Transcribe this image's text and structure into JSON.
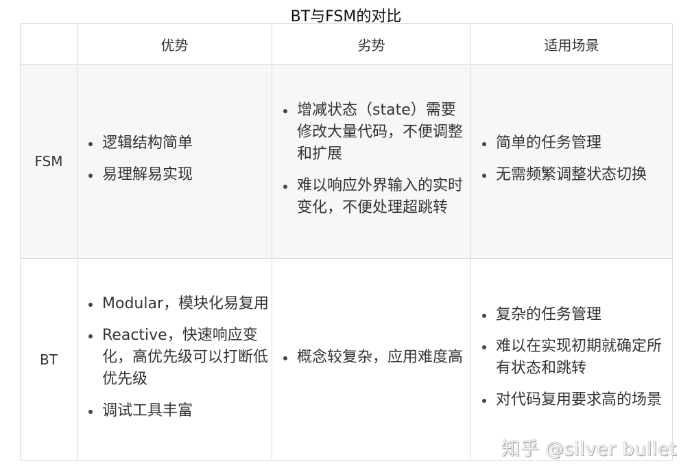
{
  "title": "BT与FSM的对比",
  "headers": [
    "",
    "优势",
    "劣势",
    "适用场景"
  ],
  "rows": [
    {
      "label": "FSM",
      "advantages": [
        "逻辑结构简单",
        "易理解易实现"
      ],
      "disadvantages": [
        "增减状态（state）需要修改大量代码，不便调整和扩展",
        "难以响应外界输入的实时变化，不便处理超跳转"
      ],
      "scenarios": [
        "简单的任务管理",
        "无需频繁调整状态切换"
      ]
    },
    {
      "label": "BT",
      "advantages": [
        "Modular，模块化易复用",
        "Reactive，快速响应变化，高优先级可以打断低优先级",
        "调试工具丰富"
      ],
      "disadvantages": [
        "概念较复杂，应用难度高"
      ],
      "scenarios": [
        "复杂的任务管理",
        "难以在实现初期就确定所有状态和跳转",
        "对代码复用要求高的场景"
      ]
    }
  ],
  "watermark": "知乎 @silver bullet"
}
